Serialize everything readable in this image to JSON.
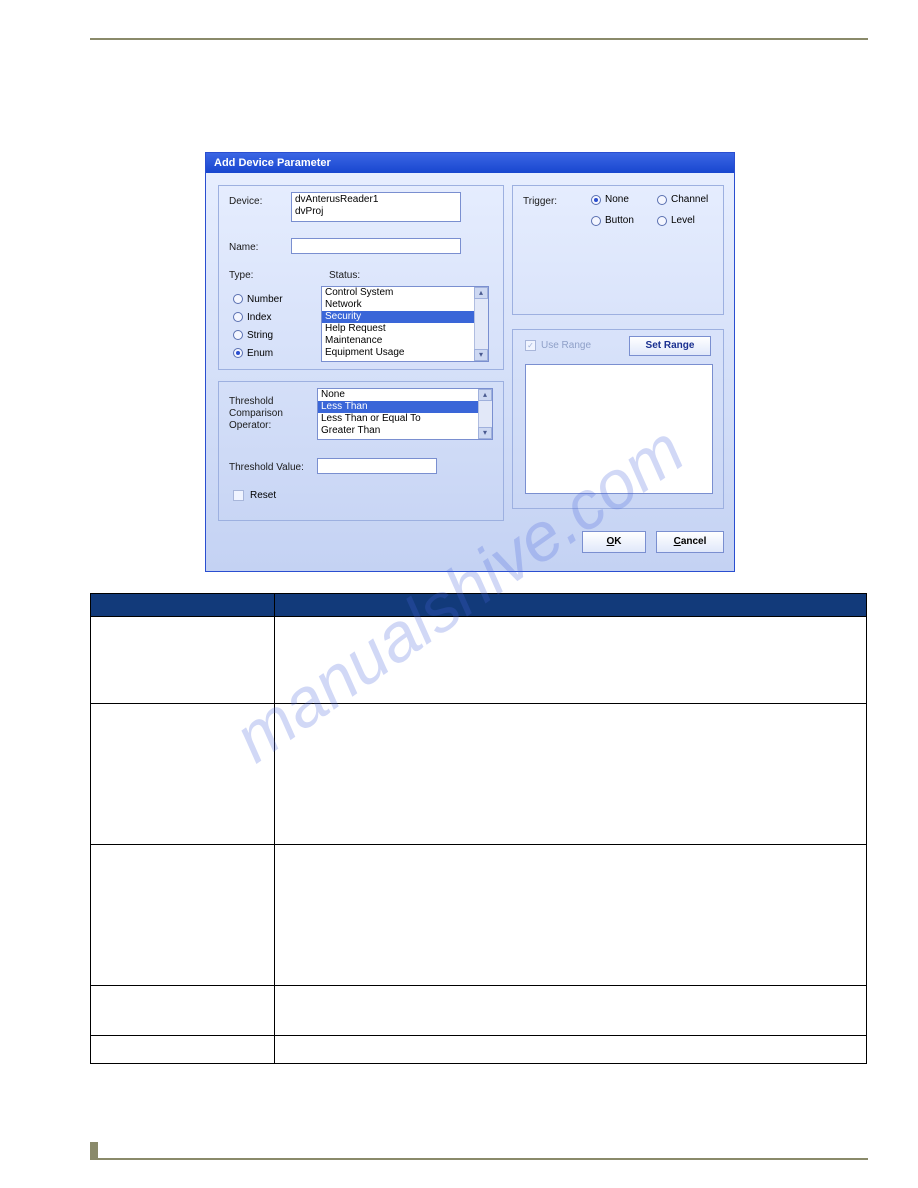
{
  "watermark": "manualshive.com",
  "dialog": {
    "title": "Add Device Parameter",
    "labels": {
      "device": "Device:",
      "name": "Name:",
      "type": "Type:",
      "status": "Status:",
      "trigger": "Trigger:",
      "use_range": "Use Range",
      "set_range": "Set Range",
      "tco": "Threshold Comparison Operator:",
      "threshold_value": "Threshold Value:",
      "reset": "Reset",
      "ok_prefix": "O",
      "ok_rest": "K",
      "cancel_prefix": "C",
      "cancel_rest": "ancel"
    },
    "device_items": [
      "dvAnterusReader1",
      "dvProj"
    ],
    "name_value": "",
    "type_options": {
      "number": "Number",
      "index": "Index",
      "string": "String",
      "enum": "Enum"
    },
    "type_selected": "enum",
    "status_items": [
      "Control System",
      "Network",
      "Security",
      "Help Request",
      "Maintenance",
      "Equipment Usage"
    ],
    "status_selected_index": 2,
    "trigger_options": {
      "none": "None",
      "channel": "Channel",
      "button": "Button",
      "level": "Level"
    },
    "trigger_selected": "none",
    "tco_items": [
      "None",
      "Less Than",
      "Less Than or Equal To",
      "Greater Than"
    ],
    "tco_selected_index": 1,
    "threshold_value": "",
    "reset_checked": false,
    "use_range_checked": true
  },
  "table": {
    "header": [
      "",
      ""
    ],
    "rows": [
      [
        "",
        ""
      ],
      [
        "",
        ""
      ],
      [
        "",
        ""
      ],
      [
        "",
        ""
      ],
      [
        "",
        ""
      ]
    ]
  }
}
